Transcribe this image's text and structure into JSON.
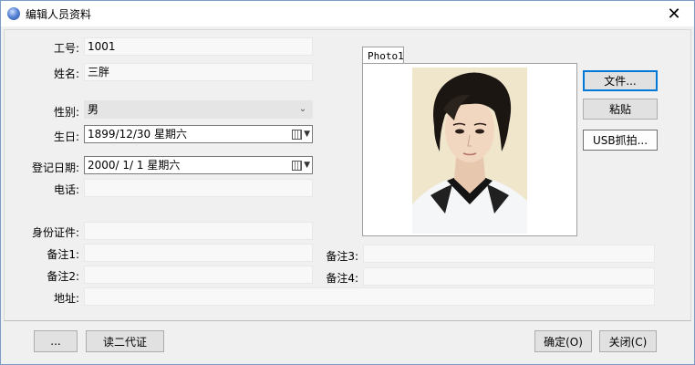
{
  "window": {
    "title": "编辑人员资料"
  },
  "form": {
    "id_label": "工号:",
    "id_value": "1001",
    "name_label": "姓名:",
    "name_value": "三胖",
    "gender_label": "性别:",
    "gender_value": "男",
    "birthday_label": "生日:",
    "birthday_value": "1899/12/30 星期六",
    "regdate_label": "登记日期:",
    "regdate_value": "2000/ 1/ 1 星期六",
    "phone_label": "电话:",
    "phone_value": "",
    "idcard_label": "身份证件:",
    "idcard_value": "",
    "note1_label": "备注1:",
    "note1_value": "",
    "note2_label": "备注2:",
    "note2_value": "",
    "note3_label": "备注3:",
    "note3_value": "",
    "note4_label": "备注4:",
    "note4_value": "",
    "address_label": "地址:",
    "address_value": ""
  },
  "photo": {
    "tab_label": "Photo1"
  },
  "side_buttons": {
    "file": "文件...",
    "paste": "粘贴",
    "usb": "USB抓拍..."
  },
  "footer": {
    "more": "...",
    "read_id": "读二代证",
    "ok": "确定(O)",
    "close": "关闭(C)"
  },
  "colors": {
    "accent": "#0078d7",
    "window_bg": "#f0f0f0"
  }
}
